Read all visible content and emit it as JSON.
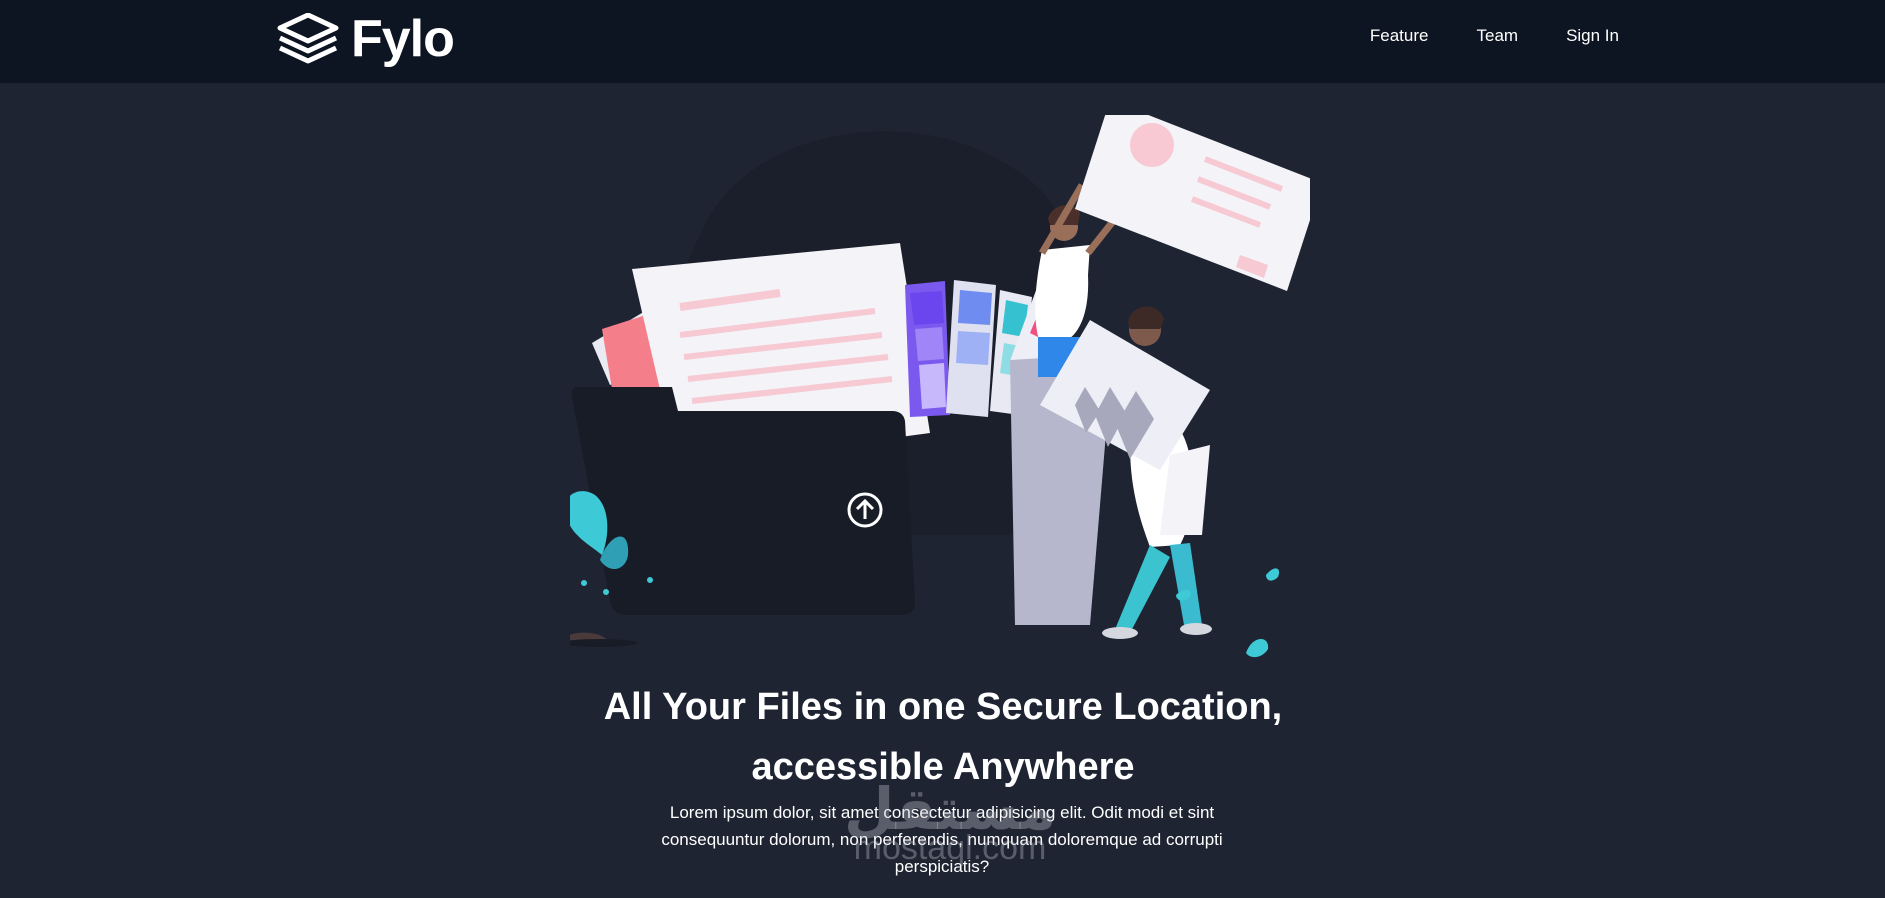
{
  "brand": {
    "name": "Fylo",
    "logo_icon": "stacked-layers-icon"
  },
  "nav": {
    "items": [
      {
        "label": "Feature"
      },
      {
        "label": "Team"
      },
      {
        "label": "Sign In"
      }
    ]
  },
  "hero": {
    "title": "All Your Files in one Secure Location, accessible Anywhere",
    "description": "Lorem ipsum dolor, sit amet consectetur adipisicing elit. Odit modi et sint consequuntur dolorum, non perferendis, numquam doloremque ad corrupti perspiciatis?",
    "illustration_icon": "upload-arrow-icon"
  },
  "watermark": {
    "arabic": "مستقل",
    "latin": "mostaql.com"
  },
  "colors": {
    "navbar_bg": "#0d1422",
    "page_bg": "#1f2433",
    "text": "#ffffff",
    "accent_teal": "#3ec9d6",
    "accent_pink": "#f4a7b6"
  }
}
